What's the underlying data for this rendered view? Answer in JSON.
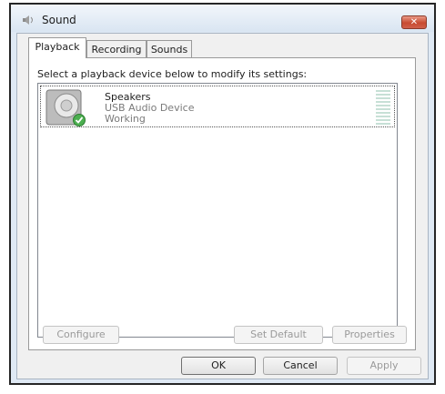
{
  "window": {
    "title": "Sound"
  },
  "tabs": [
    {
      "label": "Playback"
    },
    {
      "label": "Recording"
    },
    {
      "label": "Sounds"
    }
  ],
  "playback": {
    "instruction": "Select a playback device below to modify its settings:",
    "devices": [
      {
        "name": "Speakers",
        "description": "USB Audio Device",
        "status": "Working",
        "icon": "speaker-icon",
        "default": true
      }
    ]
  },
  "buttons": {
    "configure": "Configure",
    "set_default": "Set Default",
    "properties": "Properties",
    "ok": "OK",
    "cancel": "Cancel",
    "apply": "Apply"
  },
  "colors": {
    "close_button": "#c84a30",
    "status_check": "#4caf50"
  }
}
